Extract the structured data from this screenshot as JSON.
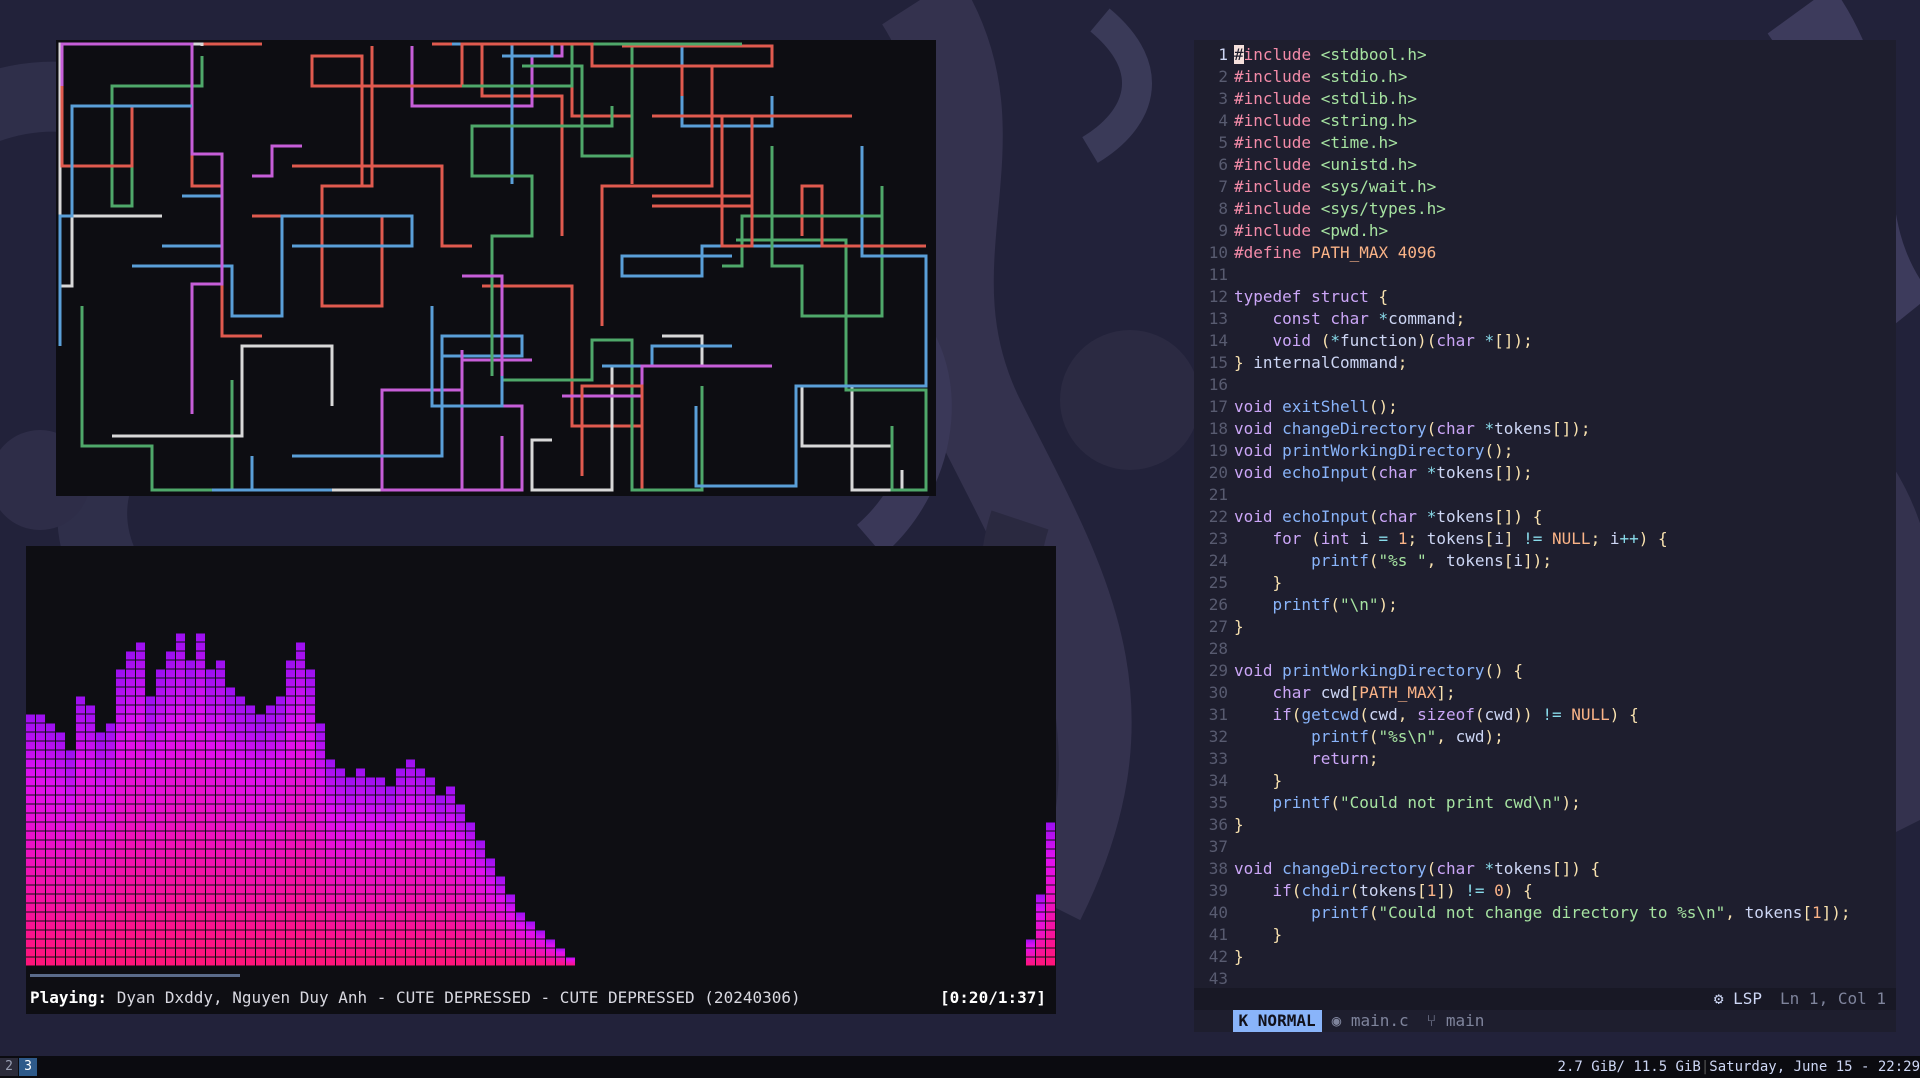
{
  "taskbar": {
    "workspaces": [
      "2",
      "3"
    ],
    "active_workspace": "3",
    "memory": "2.7 GiB/ 11.5 GiB",
    "datetime": "Saturday, June 15 - 22:29"
  },
  "music_visualizer": {
    "playing_label": "Playing:",
    "track": " Dyan Dxddy, Nguyen Duy Anh - CUTE DEPRESSED - CUTE DEPRESSED (20240306)",
    "time": "[0:20/1:37]",
    "progress_fraction": 0.206,
    "bar_levels": [
      28,
      28,
      27,
      26,
      24,
      30,
      29,
      26,
      27,
      33,
      35,
      36,
      30,
      33,
      35,
      37,
      34,
      37,
      33,
      34,
      31,
      30,
      29,
      28,
      29,
      30,
      34,
      36,
      33,
      27,
      23,
      22,
      21,
      22,
      21,
      21,
      20,
      22,
      23,
      22,
      21,
      19,
      20,
      18,
      16,
      14,
      12,
      10,
      8,
      6,
      5,
      4,
      3,
      2,
      1,
      0,
      0,
      0,
      0,
      0,
      0,
      0,
      0,
      0,
      0,
      0,
      0,
      0,
      0,
      0,
      0,
      0,
      0,
      0,
      0,
      0,
      0,
      0,
      0,
      0,
      0,
      0,
      0,
      0,
      0,
      0,
      0,
      0,
      0,
      0,
      0,
      0,
      0,
      0,
      0,
      0,
      0,
      0,
      0,
      0,
      3,
      8,
      16
    ]
  },
  "editor": {
    "current_line": 1,
    "lines": [
      "#include <stdbool.h>",
      "#include <stdio.h>",
      "#include <stdlib.h>",
      "#include <string.h>",
      "#include <time.h>",
      "#include <unistd.h>",
      "#include <sys/wait.h>",
      "#include <sys/types.h>",
      "#include <pwd.h>",
      "#define PATH_MAX 4096",
      "",
      "typedef struct {",
      "    const char *command;",
      "    void (*function)(char *[]);",
      "} internalCommand;",
      "",
      "void exitShell();",
      "void changeDirectory(char *tokens[]);",
      "void printWorkingDirectory();",
      "void echoInput(char *tokens[]);",
      "",
      "void echoInput(char *tokens[]) {",
      "    for (int i = 1; tokens[i] != NULL; i++) {",
      "        printf(\"%s \", tokens[i]);",
      "    }",
      "    printf(\"\\n\");",
      "}",
      "",
      "void printWorkingDirectory() {",
      "    char cwd[PATH_MAX];",
      "    if(getcwd(cwd, sizeof(cwd)) != NULL) {",
      "        printf(\"%s\\n\", cwd);",
      "        return;",
      "    }",
      "    printf(\"Could not print cwd\\n\");",
      "}",
      "",
      "void changeDirectory(char *tokens[]) {",
      "    if(chdir(tokens[1]) != 0) {",
      "        printf(\"Could not change directory to %s\\n\", tokens[1]);",
      "    }",
      "}",
      ""
    ],
    "status": {
      "mode": "NORMAL",
      "file": "main.c",
      "branch": "main",
      "lsp": "LSP",
      "position": "Ln 1, Col 1"
    }
  },
  "colors": {
    "pipe_red": "#e05a4f",
    "pipe_blue": "#5a9fd8",
    "pipe_green": "#4fa86a",
    "pipe_magenta": "#c65ed8",
    "pipe_white": "#d8d8d8",
    "viz_top": "#9b10f0",
    "viz_bottom": "#ff1478"
  }
}
